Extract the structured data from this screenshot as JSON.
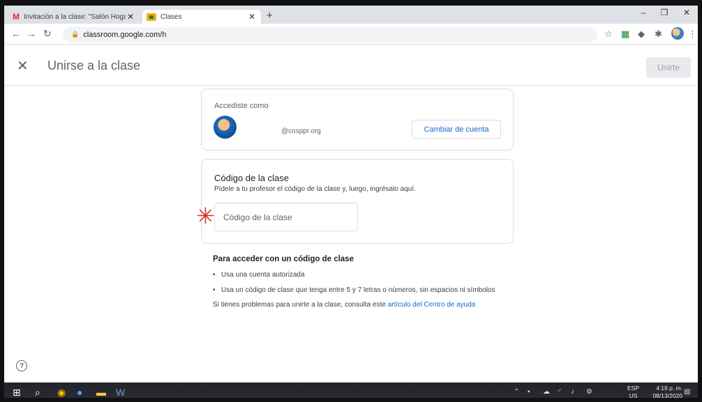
{
  "browser": {
    "tabs": [
      {
        "label": "Invitación a la clase: \"Salón Hoga",
        "icon": "gmail-icon"
      },
      {
        "label": "Clases",
        "icon": "classroom-icon"
      }
    ],
    "url": "classroom.google.com/h"
  },
  "header": {
    "title": "Unirse a la clase",
    "join_label": "Unirte"
  },
  "account": {
    "label": "Accediste como",
    "email": "@cnsppr.org",
    "switch_label": "Cambiar de cuenta"
  },
  "class_code": {
    "title": "Código de la clase",
    "subtitle": "Pídele a tu profesor el código de la clase y, luego, ingrésalo aquí.",
    "placeholder": "Código de la clase"
  },
  "info": {
    "title": "Para acceder con un código de clase",
    "items": [
      "Usa una cuenta autorizada",
      "Usa un código de clase que tenga entre 5 y 7 letras o números, sin espacios ni símbolos"
    ],
    "footer_text": "Si tienes problemas para unirte a la clase, consulta este ",
    "footer_link": "artículo del Centro de ayuda"
  },
  "taskbar": {
    "lang_top": "ESP",
    "lang_bottom": "US",
    "time": "4:19 p. m.",
    "date": "08/13/2020"
  },
  "colors": {
    "accent": "#1967d2",
    "required": "#d93025"
  }
}
